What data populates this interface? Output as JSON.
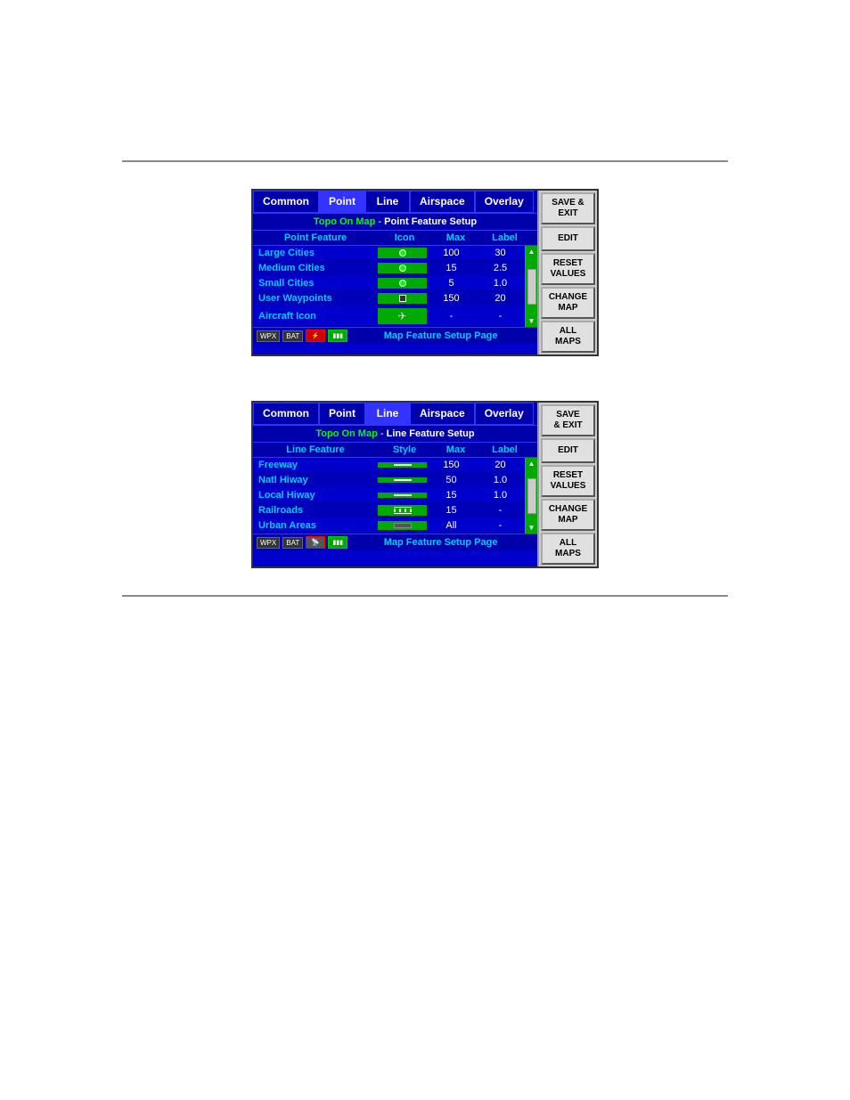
{
  "page": {
    "background": "#ffffff"
  },
  "panel1": {
    "tabs": [
      {
        "label": "Common",
        "active": false
      },
      {
        "label": "Point",
        "active": true
      },
      {
        "label": "Line",
        "active": false
      },
      {
        "label": "Airspace",
        "active": false
      },
      {
        "label": "Overlay",
        "active": false
      }
    ],
    "title_topo": "Topo On Map",
    "title_dash": " - ",
    "title_feature": "Point Feature Setup",
    "col_headers": [
      "Point Feature",
      "Icon",
      "Max",
      "Label"
    ],
    "rows": [
      {
        "label": "Large Cities",
        "icon": "circle",
        "max": "100",
        "lbl": "30"
      },
      {
        "label": "Medium Cities",
        "icon": "circle",
        "max": "15",
        "lbl": "2.5"
      },
      {
        "label": "Small Cities",
        "icon": "circle",
        "max": "5",
        "lbl": "1.0"
      },
      {
        "label": "User Waypoints",
        "icon": "square",
        "max": "150",
        "lbl": "20"
      },
      {
        "label": "Aircraft Icon",
        "icon": "plane",
        "max": "-",
        "lbl": "-"
      }
    ],
    "buttons": [
      "SAVE\n& EXIT",
      "EDIT",
      "RESET\nVALUES",
      "CHANGE\nMAP",
      "ALL\nMAPS"
    ],
    "status": {
      "gps_label": "WPX",
      "bat_label": "BAT",
      "page_label": "Map Feature Setup Page"
    }
  },
  "panel2": {
    "tabs": [
      {
        "label": "Common",
        "active": false
      },
      {
        "label": "Point",
        "active": false
      },
      {
        "label": "Line",
        "active": true
      },
      {
        "label": "Airspace",
        "active": false
      },
      {
        "label": "Overlay",
        "active": false
      }
    ],
    "title_topo": "Topo On Map",
    "title_dash": " - ",
    "title_feature": "Line Feature Setup",
    "col_headers": [
      "Line Feature",
      "Style",
      "Max",
      "Label"
    ],
    "rows": [
      {
        "label": "Freeway",
        "style": "solid",
        "max": "150",
        "lbl": "20"
      },
      {
        "label": "Natl Hiway",
        "style": "solid",
        "max": "50",
        "lbl": "1.0"
      },
      {
        "label": "Local Hiway",
        "style": "solid",
        "max": "15",
        "lbl": "1.0"
      },
      {
        "label": "Railroads",
        "style": "railroad",
        "max": "15",
        "lbl": "-"
      },
      {
        "label": "Urban Areas",
        "style": "urban",
        "max": "All",
        "lbl": "-"
      }
    ],
    "buttons": [
      "SAVE\n& EXIT",
      "EDIT",
      "RESET\nVALUES",
      "CHANGE\nMAP",
      "ALL\nMAPS"
    ],
    "status": {
      "gps_label": "WPX",
      "bat_label": "BAT",
      "page_label": "Map Feature Setup Page"
    }
  }
}
